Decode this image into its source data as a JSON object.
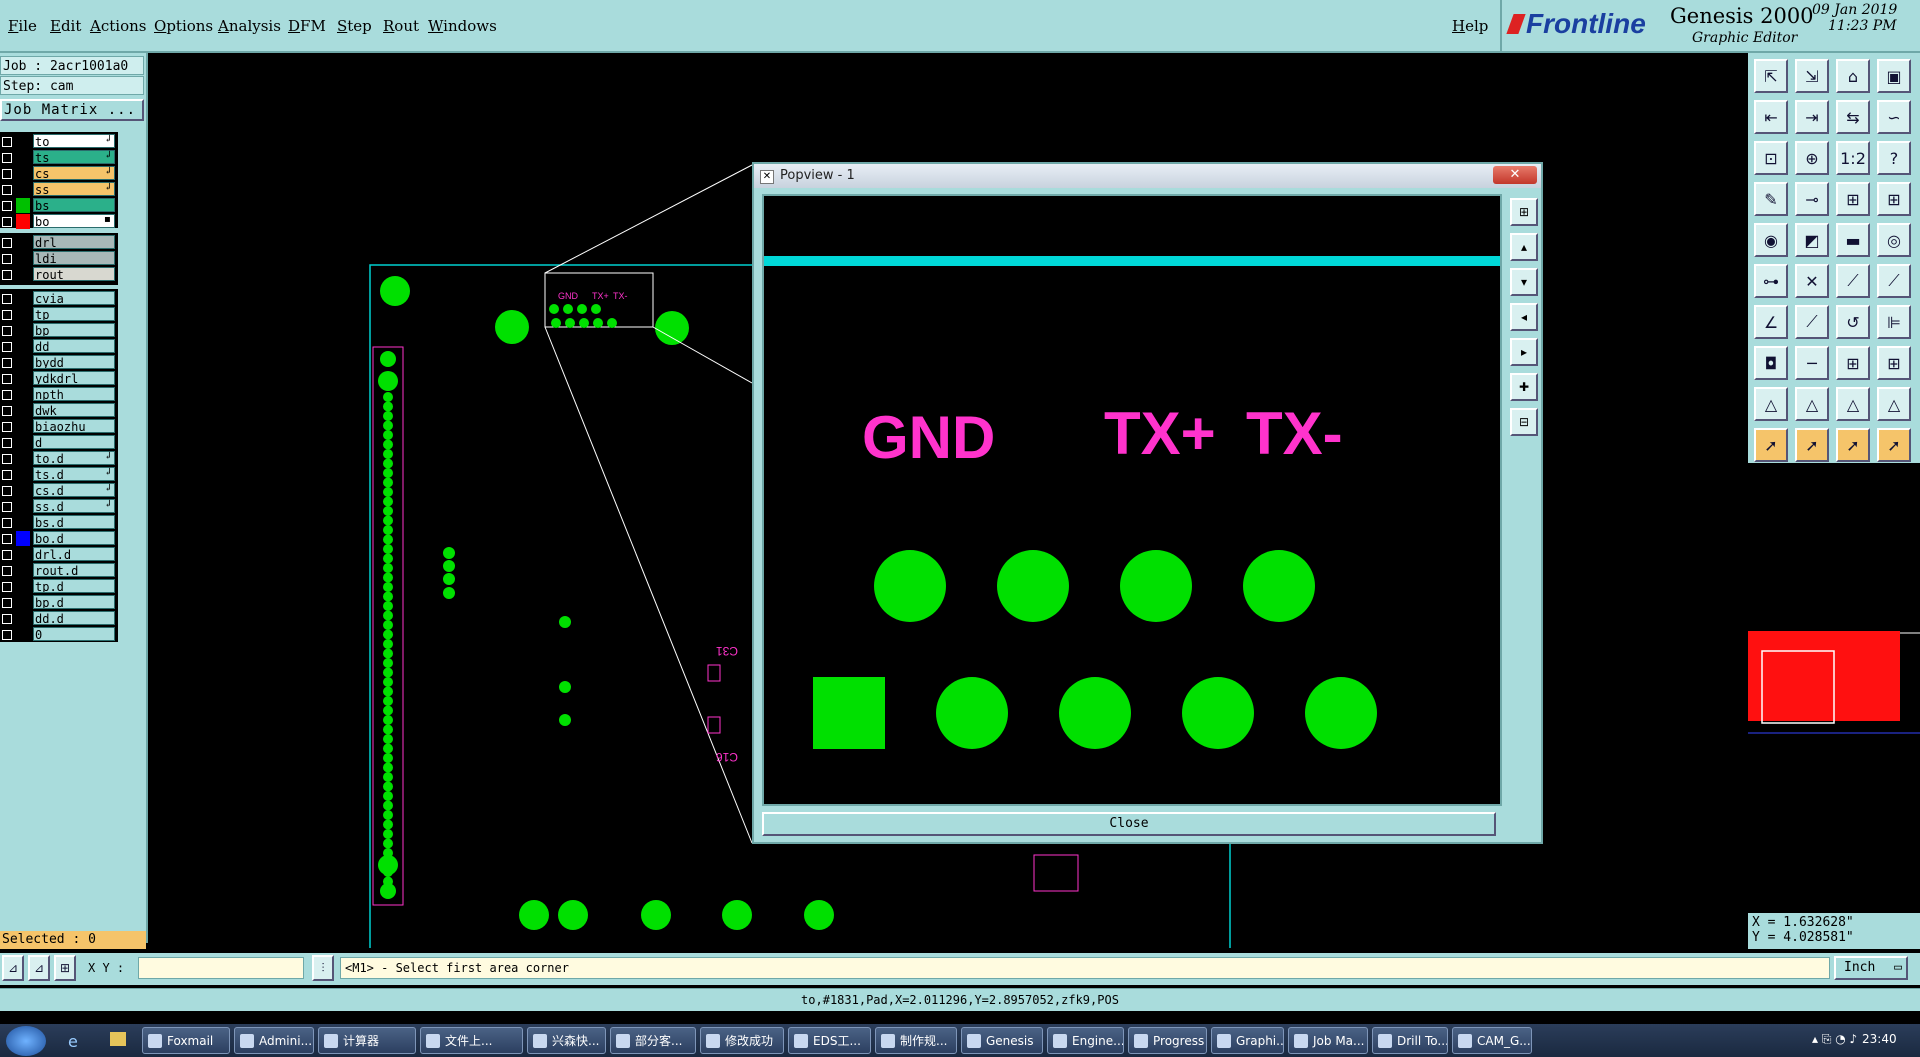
{
  "menubar": {
    "items": [
      "File",
      "Edit",
      "Actions",
      "Options",
      "Analysis",
      "DFM",
      "Step",
      "Rout",
      "Windows"
    ],
    "help": "Help"
  },
  "brand": {
    "logo": "Frontline",
    "product": "Genesis 2000",
    "subtitle": "Graphic Editor",
    "date": "09 Jan 2019",
    "time": "11:23 PM"
  },
  "job": {
    "job_line": "Job : 2acr1001a0",
    "step_line": "Step: cam",
    "matrix_button": "Job Matrix ..."
  },
  "layers": [
    {
      "name": "to",
      "sw": "#000000",
      "bg": "#ffffff",
      "mark": "↲"
    },
    {
      "name": "ts",
      "sw": "#000000",
      "bg": "#2bb08a",
      "mark": "↲"
    },
    {
      "name": "cs",
      "sw": "#000000",
      "bg": "#f5c46a",
      "mark": "↲"
    },
    {
      "name": "ss",
      "sw": "#000000",
      "bg": "#f5c46a",
      "mark": "↲"
    },
    {
      "name": "bs",
      "sw": "#00c000",
      "bg": "#2bb08a",
      "mark": ""
    },
    {
      "name": "bo",
      "sw": "#ff0000",
      "bg": "#ffffff",
      "mark": "▪"
    },
    {
      "name": "drl",
      "sw": "#000000",
      "bg": "#a8b8b8",
      "mark": ""
    },
    {
      "name": "ldi",
      "sw": "#000000",
      "bg": "#a8b8b8",
      "mark": ""
    },
    {
      "name": "rout",
      "sw": "#000000",
      "bg": "#d8d8d0",
      "mark": ""
    },
    {
      "name": "cvia",
      "sw": "#000000",
      "bg": "#a9dcdc",
      "mark": ""
    },
    {
      "name": "tp",
      "sw": "#000000",
      "bg": "#a9dcdc",
      "mark": ""
    },
    {
      "name": "bp",
      "sw": "#000000",
      "bg": "#a9dcdc",
      "mark": ""
    },
    {
      "name": "dd",
      "sw": "#000000",
      "bg": "#a9dcdc",
      "mark": ""
    },
    {
      "name": "bydd",
      "sw": "#000000",
      "bg": "#a9dcdc",
      "mark": ""
    },
    {
      "name": "ydkdrl",
      "sw": "#000000",
      "bg": "#a9dcdc",
      "mark": ""
    },
    {
      "name": "npth",
      "sw": "#000000",
      "bg": "#a9dcdc",
      "mark": ""
    },
    {
      "name": "dwk",
      "sw": "#000000",
      "bg": "#a9dcdc",
      "mark": ""
    },
    {
      "name": "biaozhu",
      "sw": "#000000",
      "bg": "#a9dcdc",
      "mark": ""
    },
    {
      "name": "d",
      "sw": "#000000",
      "bg": "#a9dcdc",
      "mark": ""
    },
    {
      "name": "to.d",
      "sw": "#000000",
      "bg": "#a9dcdc",
      "mark": "↲"
    },
    {
      "name": "ts.d",
      "sw": "#000000",
      "bg": "#a9dcdc",
      "mark": "↲"
    },
    {
      "name": "cs.d",
      "sw": "#000000",
      "bg": "#a9dcdc",
      "mark": "↲"
    },
    {
      "name": "ss.d",
      "sw": "#000000",
      "bg": "#a9dcdc",
      "mark": "↲"
    },
    {
      "name": "bs.d",
      "sw": "#000000",
      "bg": "#a9dcdc",
      "mark": ""
    },
    {
      "name": "bo.d",
      "sw": "#0000ff",
      "bg": "#a9dcdc",
      "mark": ""
    },
    {
      "name": "drl.d",
      "sw": "#000000",
      "bg": "#a9dcdc",
      "mark": ""
    },
    {
      "name": "rout.d",
      "sw": "#000000",
      "bg": "#a9dcdc",
      "mark": ""
    },
    {
      "name": "tp.d",
      "sw": "#000000",
      "bg": "#a9dcdc",
      "mark": ""
    },
    {
      "name": "bp.d",
      "sw": "#000000",
      "bg": "#a9dcdc",
      "mark": ""
    },
    {
      "name": "dd.d",
      "sw": "#000000",
      "bg": "#a9dcdc",
      "mark": ""
    },
    {
      "name": "0",
      "sw": "#000000",
      "bg": "#a9dcdc",
      "mark": ""
    }
  ],
  "selected": "Selected : 0",
  "canvas": {
    "labels": {
      "gnd": "GND",
      "txp": "TX+",
      "txm": "TX-",
      "c3": "C31",
      "c16": "C16"
    },
    "pad_color": "#00e000",
    "text_color": "#ff33cc",
    "outline_color": "#00d0d0"
  },
  "popview": {
    "title": "Popview - 1",
    "close_x": "✕",
    "close_button": "Close",
    "labels": {
      "gnd": "GND",
      "txp": "TX+",
      "txm": "TX-"
    }
  },
  "coords": {
    "x": "X = 1.632628\"",
    "y": "Y = 4.028581\""
  },
  "command": {
    "xy_label": "X Y :",
    "xy_value": "",
    "prompt": "<M1> - Select first area corner",
    "units": "Inch"
  },
  "status": "to,#1831,Pad,X=2.011296,Y=2.8957052,zfk9,POS",
  "taskbar": {
    "items": [
      "Foxmail",
      "Admini...",
      "计算器",
      "文件上...",
      "兴森快...",
      "部分客...",
      "修改成功",
      "EDS工...",
      "制作规...",
      "Genesis",
      "Engine...",
      "Progress",
      "Graphi...",
      "Job Ma...",
      "Drill To...",
      "CAM_G..."
    ],
    "clock": "23:40"
  }
}
